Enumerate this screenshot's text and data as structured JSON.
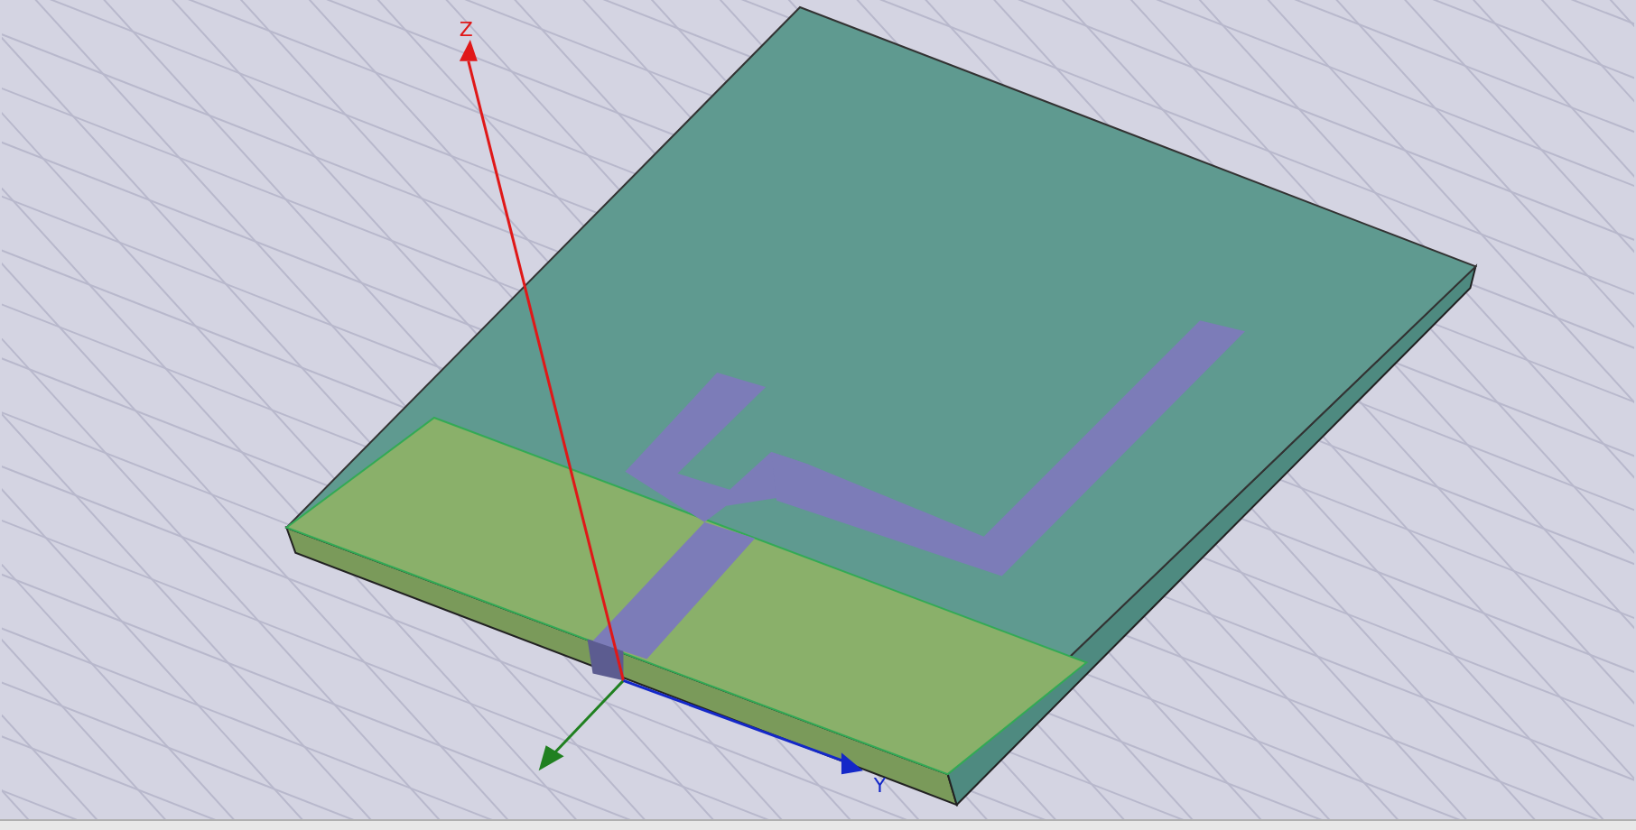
{
  "viewport": {
    "axes": [
      {
        "label": "Z",
        "color": "#e01818"
      },
      {
        "label": "Y",
        "color": "#1428c8"
      }
    ]
  }
}
